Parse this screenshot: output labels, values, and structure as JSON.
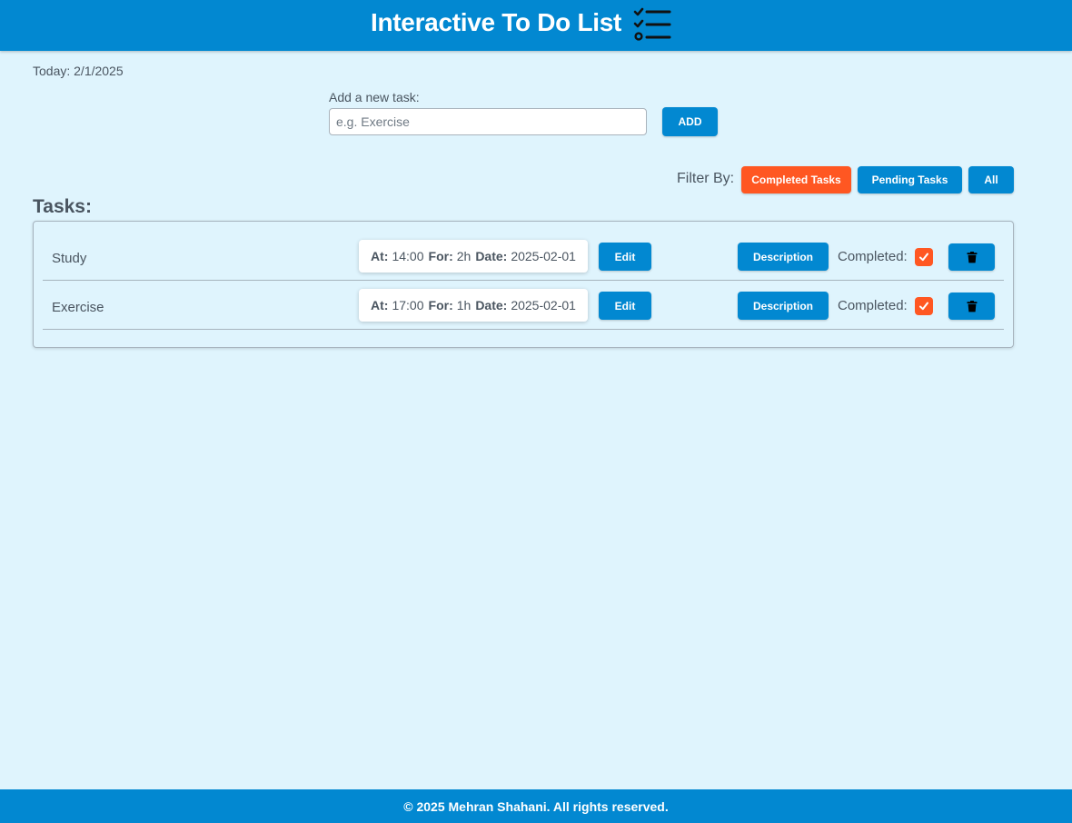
{
  "header": {
    "title": "Interactive To Do List",
    "icon": "checklist-icon"
  },
  "today": "Today: 2/1/2025",
  "add_task": {
    "label": "Add a new task:",
    "placeholder": "e.g. Exercise",
    "value": "",
    "button_label": "ADD"
  },
  "filter": {
    "label": "Filter By:",
    "completed_label": "Completed Tasks",
    "pending_label": "Pending Tasks",
    "all_label": "All",
    "active": "Completed Tasks"
  },
  "tasks_heading": "Tasks:",
  "tasks": [
    {
      "name": "Study",
      "at_label": "At:",
      "at": "14:00",
      "for_label": "For:",
      "for": "2h",
      "date_label": "Date:",
      "date": "2025-02-01",
      "edit_label": "Edit",
      "description_label": "Description",
      "completed_label": "Completed:",
      "completed": true,
      "delete_icon": "trash-icon"
    },
    {
      "name": "Exercise",
      "at_label": "At:",
      "at": "17:00",
      "for_label": "For:",
      "for": "1h",
      "date_label": "Date:",
      "date": "2025-02-01",
      "edit_label": "Edit",
      "description_label": "Description",
      "completed_label": "Completed:",
      "completed": true,
      "delete_icon": "trash-icon"
    }
  ],
  "footer": {
    "text": "© 2025 Mehran Shahani. All rights reserved."
  },
  "colors": {
    "primary": "#0288d1",
    "accent": "#ff5722",
    "background": "#dff4fd",
    "text": "#4a5560"
  }
}
